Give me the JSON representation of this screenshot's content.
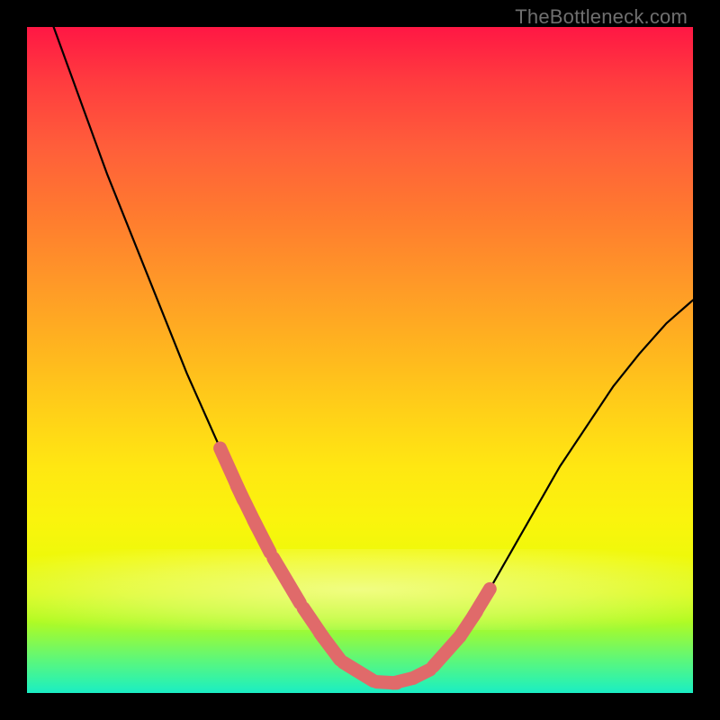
{
  "watermark": {
    "text": "TheBottleneck.com"
  },
  "chart_data": {
    "type": "line",
    "title": "",
    "xlabel": "",
    "ylabel": "",
    "xlim": [
      0,
      100
    ],
    "ylim": [
      0,
      100
    ],
    "grid": false,
    "legend": false,
    "series": [
      {
        "name": "curve",
        "x": [
          4,
          8,
          12,
          16,
          20,
          24,
          28,
          32,
          36,
          40,
          44,
          47,
          50,
          53,
          56,
          60,
          64,
          68,
          72,
          76,
          80,
          84,
          88,
          92,
          96,
          100
        ],
        "values": [
          100,
          89,
          78,
          68,
          58,
          48,
          39,
          30,
          22,
          15,
          9,
          5,
          2.5,
          1.5,
          1.5,
          3,
          7,
          13,
          20,
          27,
          34,
          40,
          46,
          51,
          55.5,
          59
        ]
      }
    ],
    "markers": {
      "name": "highlight-pills",
      "color": "#e06a6a",
      "segments_x": [
        [
          29,
          32.5
        ],
        [
          31.5,
          34.5
        ],
        [
          34,
          36.5
        ],
        [
          37,
          41
        ],
        [
          41.5,
          44.5
        ],
        [
          44,
          47
        ],
        [
          47.5,
          52
        ],
        [
          52.5,
          55.5
        ],
        [
          55,
          58
        ],
        [
          58,
          60.5
        ],
        [
          61,
          65
        ],
        [
          65,
          67.5
        ],
        [
          67,
          69.5
        ]
      ]
    }
  }
}
